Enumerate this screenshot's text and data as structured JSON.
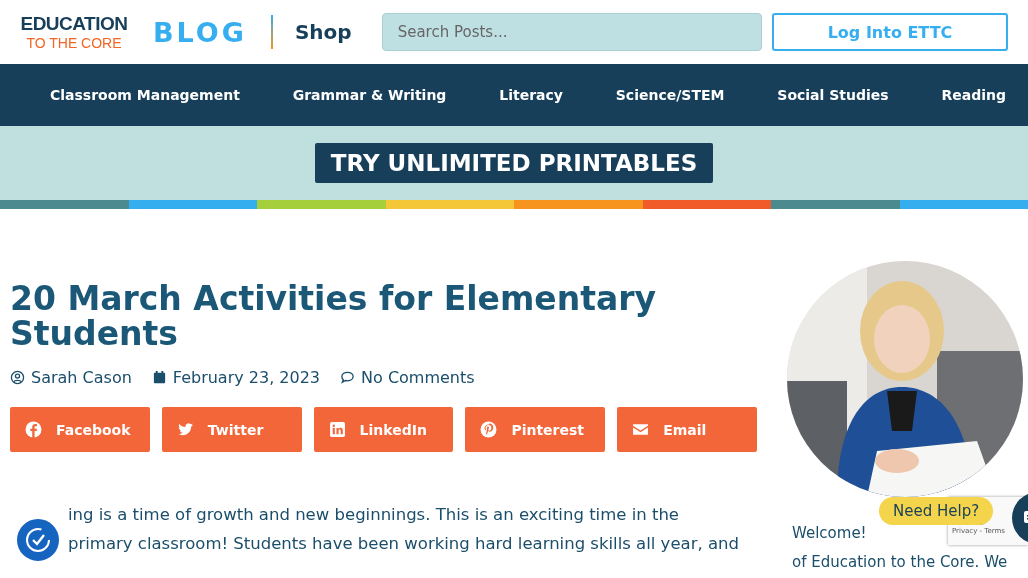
{
  "header": {
    "logo_top": "EDUCATION",
    "logo_bottom": "TO THE CORE",
    "blog": "BLOG",
    "shop": "Shop",
    "search": {
      "placeholder": "Search Posts..."
    },
    "login": "Log Into ETTC"
  },
  "nav": [
    "Classroom Management",
    "Grammar & Writing",
    "Literacy",
    "Science/STEM",
    "Social Studies",
    "Reading"
  ],
  "banner": {
    "button": "TRY UNLIMITED PRINTABLES"
  },
  "article": {
    "title": "20 March Activities for Elementary Students",
    "author": "Sarah Cason",
    "date": "February 23, 2023",
    "comments": "No Comments",
    "share": [
      {
        "kind": "facebook",
        "label": "Facebook"
      },
      {
        "kind": "twitter",
        "label": "Twitter"
      },
      {
        "kind": "linkedin",
        "label": "LinkedIn"
      },
      {
        "kind": "pinterest",
        "label": "Pinterest"
      },
      {
        "kind": "email",
        "label": "Email"
      }
    ],
    "lines": [
      "ing is a time of growth and new beginnings. This is an exciting time in the",
      "primary classroom! Students have been working hard learning skills all year, and"
    ]
  },
  "sidebar": {
    "lines": [
      "Welcome!",
      "of Education to the Core. We"
    ]
  },
  "help": "Need Help?",
  "recaptcha": "Privacy - Terms"
}
